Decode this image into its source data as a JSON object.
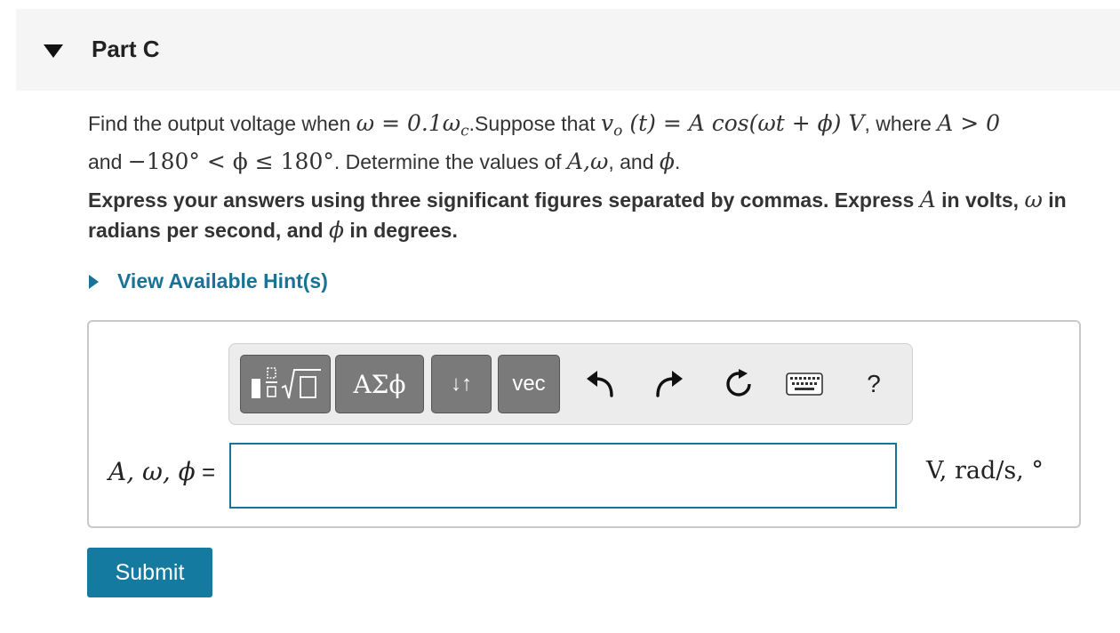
{
  "header": {
    "title": "Part C",
    "toggle_icon": "triangle-down-icon"
  },
  "question": {
    "t1": "Find the output voltage when ",
    "t2": ".Suppose that ",
    "t3": ", where ",
    "t4": "and ",
    "t5": ". Determine the values of ",
    "t6": ", and ",
    "t7": ".",
    "math_omega_cond": "ω = 0.1ω",
    "math_c": "c",
    "math_vo": "v",
    "math_o": "o",
    "math_vo_rest": " (t) = A cos(ωt + ϕ) V",
    "math_A_gt": "A > 0",
    "math_phi_range": "−180° < ϕ ≤ 180°",
    "math_A_omega": "A,ω",
    "math_phi": "ϕ"
  },
  "instructions": {
    "t1": "Express your answers using three significant figures separated by commas. Express ",
    "t2": " in volts, ",
    "t3": " in radians per second, and ",
    "t4": " in degrees.",
    "m_A": "A",
    "m_omega": "ω",
    "m_phi": "ϕ"
  },
  "hint": {
    "label": "View Available Hint(s)"
  },
  "toolbar": {
    "greek_label": "ΑΣϕ",
    "arrows_label": "↓↑",
    "vec_label": "vec",
    "help_label": "?"
  },
  "answer": {
    "label_vars": "A, ω, ϕ",
    "label_eq": " =",
    "value": "",
    "placeholder": "",
    "units": "V, rad/s, °"
  },
  "submit": {
    "label": "Submit"
  },
  "colors": {
    "accent": "#1a7295",
    "button": "#147aa0",
    "toolbar_button": "#7a7a7a"
  }
}
